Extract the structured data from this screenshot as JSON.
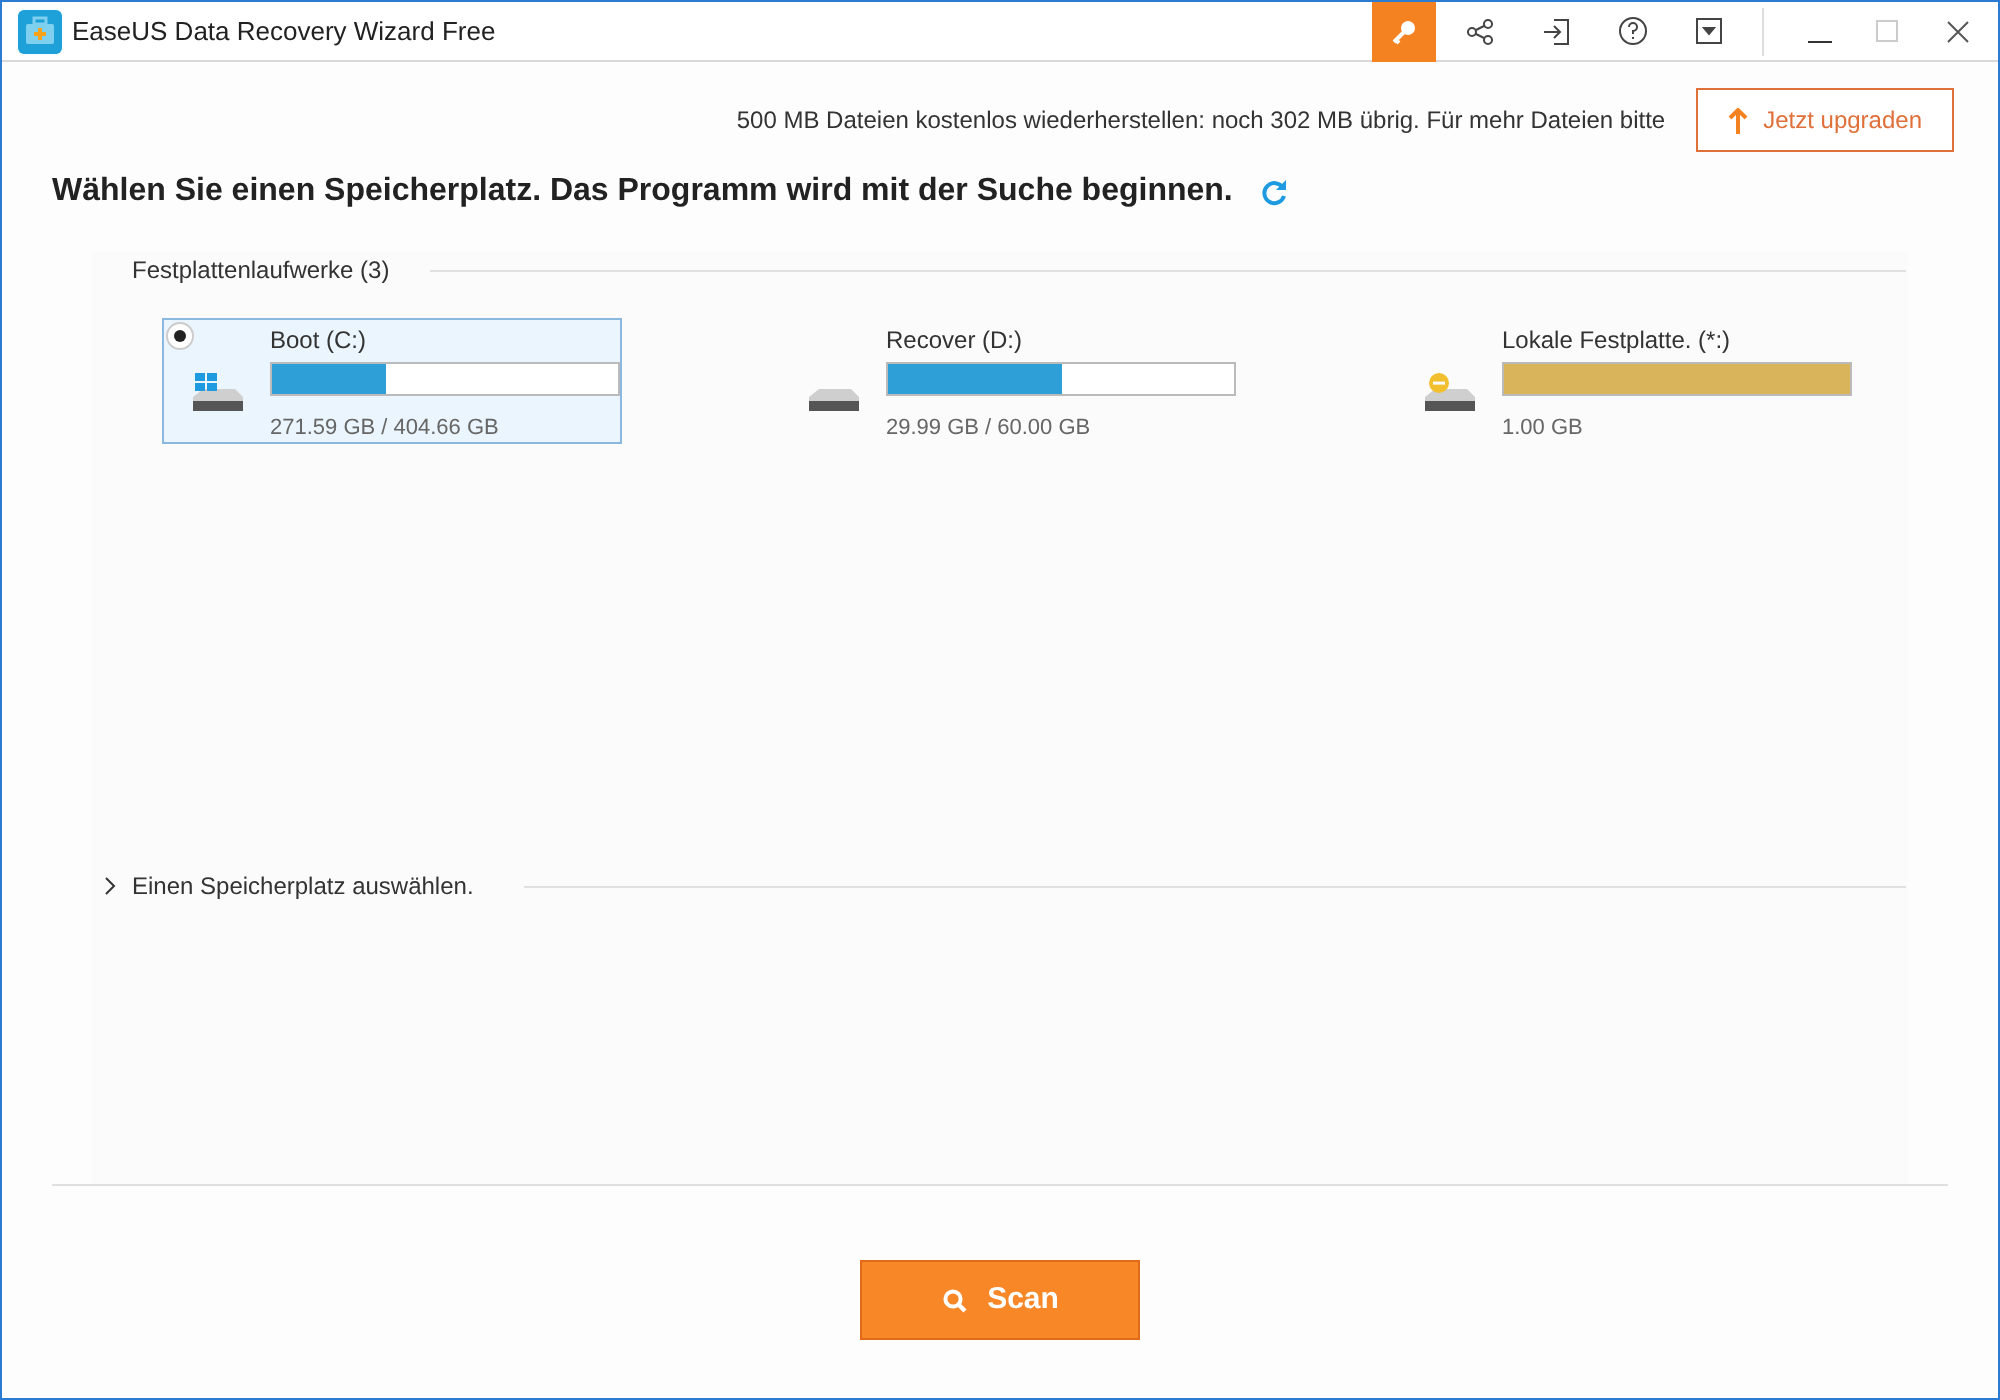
{
  "window": {
    "title": "EaseUS Data Recovery Wizard Free"
  },
  "notice": {
    "text": "500 MB Dateien kostenlos wiederherstellen: noch 302 MB übrig. Für mehr Dateien bitte",
    "upgrade_button": "Jetzt upgraden"
  },
  "heading": "Wählen Sie einen Speicherplatz. Das Programm wird mit der Suche beginnen.",
  "drives_section": {
    "title": "Festplattenlaufwerke (3)",
    "drives": [
      {
        "name": "Boot (C:)",
        "size": "271.59 GB / 404.66 GB",
        "kind": "system",
        "level": 0.33,
        "color": "#2f9fd8",
        "selected": true
      },
      {
        "name": "Recover (D:)",
        "size": "29.99 GB / 60.00 GB",
        "kind": "plain",
        "level": 0.5,
        "color": "#2f9fd8",
        "selected": false
      },
      {
        "name": "Lokale Festplatte. (*:)",
        "size": "1.00 GB",
        "kind": "warning",
        "level": 1,
        "color": "#d9b45a",
        "selected": false
      }
    ]
  },
  "location_section": {
    "title": "Einen Speicherplatz auswählen.",
    "expanded": false
  },
  "scan_button": "Scan"
}
